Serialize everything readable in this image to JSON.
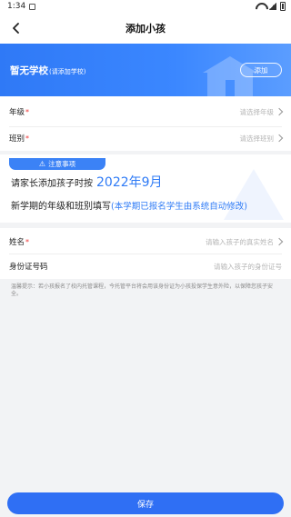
{
  "status_bar": {
    "time": "1:34"
  },
  "nav": {
    "title": "添加小孩"
  },
  "school": {
    "name": "暂无学校",
    "hint": "(请添加学校)",
    "add_label": "添加"
  },
  "form1": {
    "grade": {
      "label": "年级",
      "required_mark": "*",
      "placeholder": "请选择年级"
    },
    "class": {
      "label": "班别",
      "required_mark": "*",
      "placeholder": "请选择班别"
    }
  },
  "notice": {
    "badge_label": "注意事项",
    "line1_text": "请家长添加孩子时按",
    "line1_date": "2022年9月",
    "line2_text": "新学期的年级和班别填写",
    "line2_note": "(本学期已报名学生由系统自动修改)"
  },
  "form2": {
    "name": {
      "label": "姓名",
      "required_mark": "*",
      "placeholder": "请输入孩子的真实姓名"
    },
    "id_card": {
      "label": "身份证号码",
      "placeholder": "请输入孩子的身份证号"
    }
  },
  "warm_tip": "温馨提示：若小孩报名了校内托管课程，今托管平台将会用该身份证为小孩投保学生意外险，以保障您孩子安全。",
  "footer": {
    "save_label": "保存"
  },
  "colors": {
    "primary": "#2f6ff4",
    "banner": "#3b87ff",
    "required": "#e33333"
  },
  "icons": {
    "back": "chevron-left-icon",
    "warning": "warning-icon",
    "chevron": "chevron-right-icon"
  }
}
